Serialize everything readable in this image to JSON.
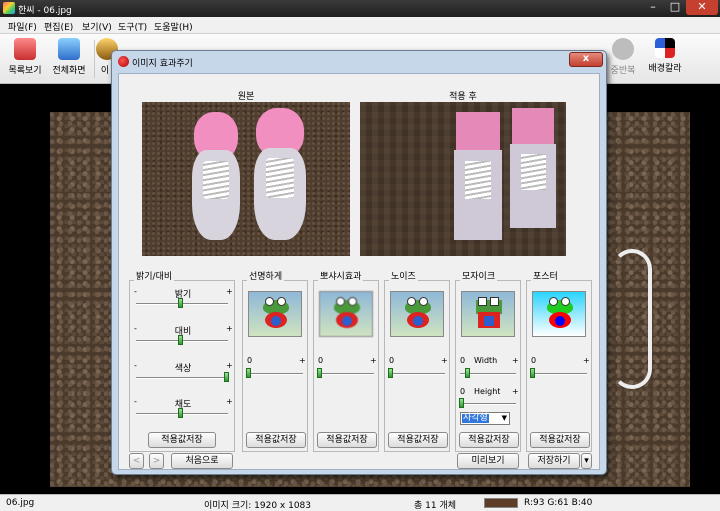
{
  "app": {
    "title": "한씨 - 06.jpg",
    "menu": [
      "파일(F)",
      "편집(E)",
      "보기(V)",
      "도구(T)",
      "도움말(H)"
    ],
    "toolbar": {
      "list_view": "목록보기",
      "fullscreen": "전체화면",
      "truncated_item": "이",
      "overlap_item": "중반복",
      "bg_color": "배경칼라"
    }
  },
  "dialog": {
    "title": "이미지 효과주기",
    "close_glyph": "x",
    "original_caption": "원본",
    "applied_caption": "적용 후",
    "panels": {
      "brightness": {
        "title": "밝기/대비",
        "sliders": [
          {
            "label": "밝기",
            "minus": "-",
            "plus": "+",
            "level": 0.5
          },
          {
            "label": "대비",
            "minus": "-",
            "plus": "+",
            "level": 0.5
          },
          {
            "label": "색상",
            "minus": "-",
            "plus": "+",
            "level": 1.0
          },
          {
            "label": "채도",
            "minus": "-",
            "plus": "+",
            "level": 0.5
          }
        ],
        "save": "적용값저장"
      },
      "sharpen": {
        "title": "선명하게",
        "value": "0",
        "plus": "+",
        "save": "적용값저장"
      },
      "blur": {
        "title": "뽀샤시효과",
        "value": "0",
        "plus": "+",
        "save": "적용값저장"
      },
      "noise": {
        "title": "노이즈",
        "value": "0",
        "plus": "+",
        "save": "적용값저장"
      },
      "mosaic": {
        "title": "모자이크",
        "width_value": "0",
        "width_label": "Width",
        "width_plus": "+",
        "height_value": "0",
        "height_label": "Height",
        "height_plus": "+",
        "shape": "사각형",
        "save": "적용값저장"
      },
      "poster": {
        "title": "포스터",
        "value": "0",
        "plus": "+",
        "save": "적용값저장"
      }
    },
    "nav_prev": "<",
    "nav_next": ">",
    "reset": "처음으로",
    "preview": "미리보기",
    "save_as": "저장하기"
  },
  "status": {
    "filename": "06.jpg",
    "image_size": "이미지 크기: 1920 x 1083",
    "count": "총 11 개체",
    "rgb": "R:93 G:61 B:40",
    "swatch_color": "#5d3d28"
  }
}
